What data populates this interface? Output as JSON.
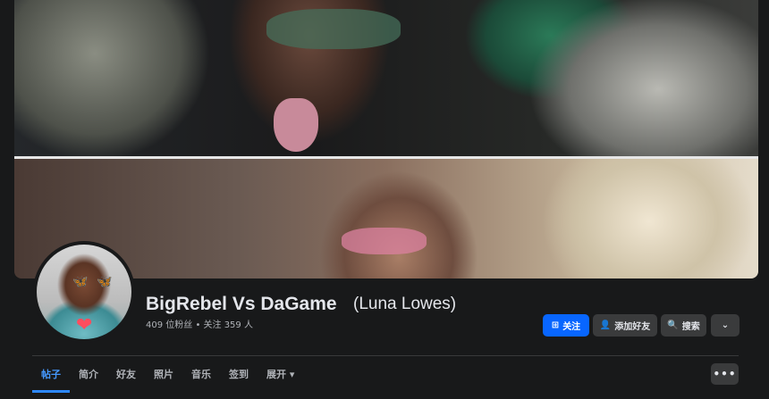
{
  "profile": {
    "name": "BigRebel Vs DaGame",
    "alternate_name": "(Luna Lowes)",
    "stats": "409 位粉丝 • 关注 359 人"
  },
  "actions": {
    "follow_label": "关注",
    "add_friend_label": "添加好友",
    "search_label": "搜索",
    "dropdown_icon": "chevron-down-icon"
  },
  "tabs": [
    {
      "label": "帖子",
      "active": true
    },
    {
      "label": "简介",
      "active": false
    },
    {
      "label": "好友",
      "active": false
    },
    {
      "label": "照片",
      "active": false
    },
    {
      "label": "音乐",
      "active": false
    },
    {
      "label": "签到",
      "active": false
    },
    {
      "label": "展开 ▾",
      "active": false
    }
  ],
  "more_options_icon": "ellipsis-icon",
  "colors": {
    "accent": "#0866ff",
    "active_tab": "#4599ff",
    "background": "#18191a",
    "button": "#3a3b3c"
  }
}
